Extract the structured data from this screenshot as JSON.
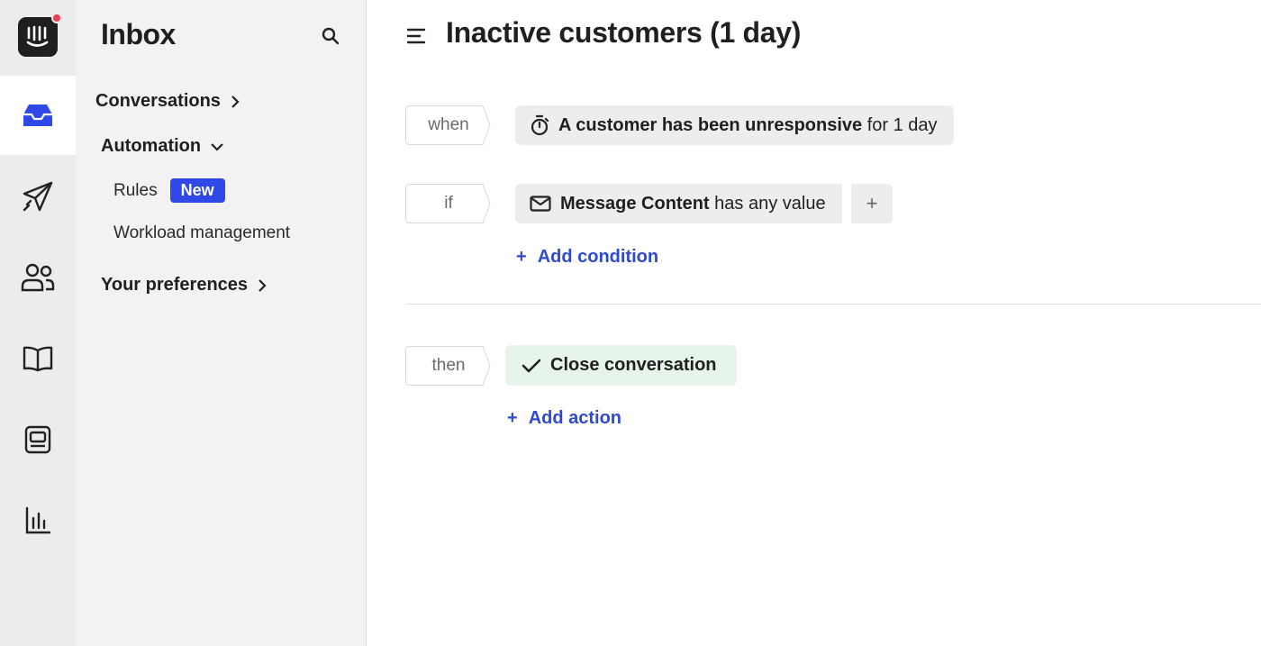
{
  "rail": {
    "items": [
      {
        "name": "inbox-icon"
      },
      {
        "name": "outbound-icon"
      },
      {
        "name": "contacts-icon"
      },
      {
        "name": "knowledge-icon"
      },
      {
        "name": "messenger-icon"
      },
      {
        "name": "reports-icon"
      }
    ]
  },
  "sidebar": {
    "title": "Inbox",
    "conversations_label": "Conversations",
    "automation_label": "Automation",
    "rules_label": "Rules",
    "rules_badge": "New",
    "workload_label": "Workload management",
    "preferences_label": "Your preferences"
  },
  "main": {
    "title": "Inactive customers (1 day)",
    "when_label": "when",
    "trigger_bold": "A customer has been unresponsive",
    "trigger_rest": "for 1 day",
    "if_label": "if",
    "condition_bold": "Message Content",
    "condition_rest": "has any value",
    "condition_plus": "+",
    "add_condition": "Add condition",
    "then_label": "then",
    "action_label": "Close conversation",
    "add_action": "Add action",
    "plus_glyph": "+"
  },
  "colors": {
    "accent": "#2f49e8",
    "link": "#2f49d1",
    "notification": "#ef3b50",
    "action_bg": "#e6f4ea"
  }
}
